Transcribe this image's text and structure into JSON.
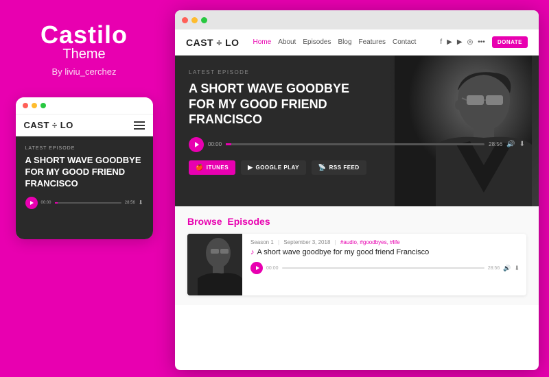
{
  "leftPanel": {
    "title": "Castilo",
    "subtitle": "Theme",
    "author": "By liviu_cerchez",
    "mobile": {
      "logo": "CAST ÷ LO",
      "hero": {
        "latestLabel": "LATEST EPISODE",
        "title": "A SHORT WAVE GOODBYE FOR MY GOOD FRIEND FRANCISCO",
        "timeStart": "00:00",
        "timeEnd": "28:56"
      }
    }
  },
  "rightPanel": {
    "nav": {
      "logo": "CAST ÷ LO",
      "links": [
        "Home",
        "About",
        "Episodes",
        "Blog",
        "Features",
        "Contact"
      ],
      "activeLink": "Home",
      "donateLabel": "DONATE"
    },
    "hero": {
      "latestLabel": "LATEST EPISODE",
      "title": "A SHORT WAVE GOODBYE FOR MY GOOD FRIEND FRANCISCO",
      "timeStart": "00:00",
      "timeEnd": "28:56",
      "buttons": {
        "itunes": "ITUNES",
        "googlePlay": "GOOGLE PLAY",
        "rssFeed": "RSS FEED"
      }
    },
    "browse": {
      "heading": "Browse",
      "headingAccent": "Episodes",
      "episode": {
        "season": "Season 1",
        "date": "September 3, 2018",
        "tags": "#audio, #goodbyes, #life",
        "title": "A short wave goodbye for my good friend Francisco",
        "timeStart": "00:00",
        "timeEnd": "28:56"
      }
    }
  }
}
